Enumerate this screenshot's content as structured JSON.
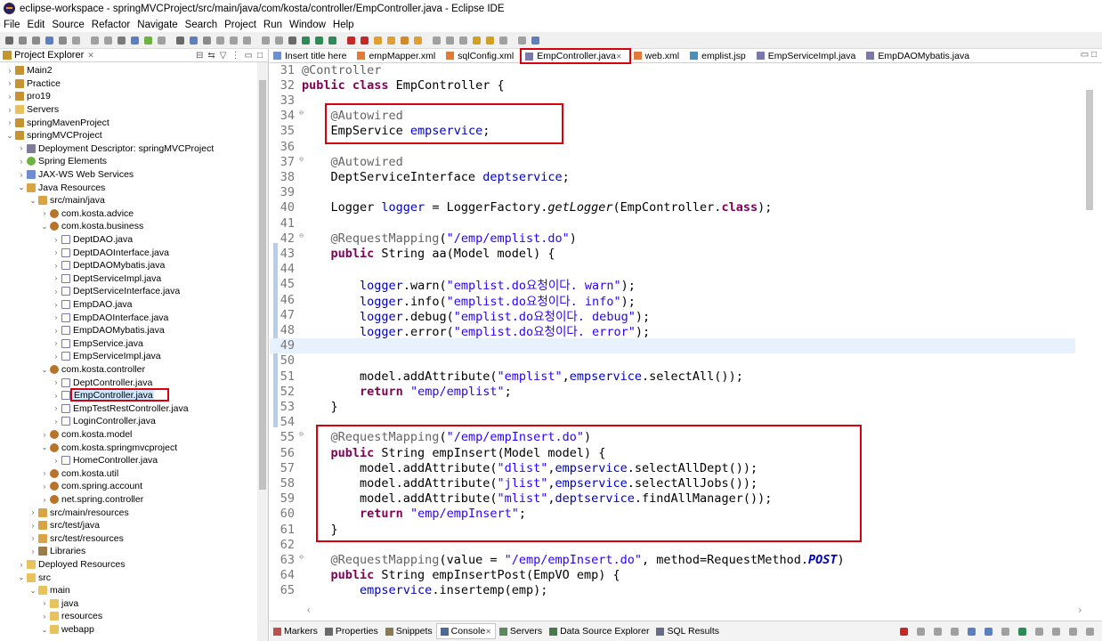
{
  "window": {
    "title": "eclipse-workspace - springMVCProject/src/main/java/com/kosta/controller/EmpController.java - Eclipse IDE"
  },
  "menu": [
    "File",
    "Edit",
    "Source",
    "Refactor",
    "Navigate",
    "Search",
    "Project",
    "Run",
    "Window",
    "Help"
  ],
  "explorer": {
    "title": "Project Explorer"
  },
  "tree": [
    {
      "label": "Main2",
      "indent": 0,
      "arrow": "›",
      "icon": "proj"
    },
    {
      "label": "Practice",
      "indent": 0,
      "arrow": "›",
      "icon": "proj"
    },
    {
      "label": "pro19",
      "indent": 0,
      "arrow": "›",
      "icon": "proj"
    },
    {
      "label": "Servers",
      "indent": 0,
      "arrow": "›",
      "icon": "folder"
    },
    {
      "label": "springMavenProject",
      "indent": 0,
      "arrow": "›",
      "icon": "proj"
    },
    {
      "label": "springMVCProject",
      "indent": 0,
      "arrow": "⌄",
      "icon": "proj"
    },
    {
      "label": "Deployment Descriptor: springMVCProject",
      "indent": 1,
      "arrow": "›",
      "icon": "dd"
    },
    {
      "label": "Spring Elements",
      "indent": 1,
      "arrow": "›",
      "icon": "spring"
    },
    {
      "label": "JAX-WS Web Services",
      "indent": 1,
      "arrow": "›",
      "icon": "web"
    },
    {
      "label": "Java Resources",
      "indent": 1,
      "arrow": "⌄",
      "icon": "src"
    },
    {
      "label": "src/main/java",
      "indent": 2,
      "arrow": "⌄",
      "icon": "src"
    },
    {
      "label": "com.kosta.advice",
      "indent": 3,
      "arrow": "›",
      "icon": "pkg"
    },
    {
      "label": "com.kosta.business",
      "indent": 3,
      "arrow": "⌄",
      "icon": "pkg"
    },
    {
      "label": "DeptDAO.java",
      "indent": 4,
      "arrow": "›",
      "icon": "java"
    },
    {
      "label": "DeptDAOInterface.java",
      "indent": 4,
      "arrow": "›",
      "icon": "java"
    },
    {
      "label": "DeptDAOMybatis.java",
      "indent": 4,
      "arrow": "›",
      "icon": "java"
    },
    {
      "label": "DeptServiceImpl.java",
      "indent": 4,
      "arrow": "›",
      "icon": "java"
    },
    {
      "label": "DeptServiceInterface.java",
      "indent": 4,
      "arrow": "›",
      "icon": "java"
    },
    {
      "label": "EmpDAO.java",
      "indent": 4,
      "arrow": "›",
      "icon": "java"
    },
    {
      "label": "EmpDAOInterface.java",
      "indent": 4,
      "arrow": "›",
      "icon": "java"
    },
    {
      "label": "EmpDAOMybatis.java",
      "indent": 4,
      "arrow": "›",
      "icon": "java"
    },
    {
      "label": "EmpService.java",
      "indent": 4,
      "arrow": "›",
      "icon": "java"
    },
    {
      "label": "EmpServiceImpl.java",
      "indent": 4,
      "arrow": "›",
      "icon": "java"
    },
    {
      "label": "com.kosta.controller",
      "indent": 3,
      "arrow": "⌄",
      "icon": "pkg"
    },
    {
      "label": "DeptController.java",
      "indent": 4,
      "arrow": "›",
      "icon": "java"
    },
    {
      "label": "EmpController.java",
      "indent": 4,
      "arrow": "›",
      "icon": "java",
      "selected": true
    },
    {
      "label": "EmpTestRestController.java",
      "indent": 4,
      "arrow": "›",
      "icon": "java"
    },
    {
      "label": "LoginController.java",
      "indent": 4,
      "arrow": "›",
      "icon": "java"
    },
    {
      "label": "com.kosta.model",
      "indent": 3,
      "arrow": "›",
      "icon": "pkg"
    },
    {
      "label": "com.kosta.springmvcproject",
      "indent": 3,
      "arrow": "⌄",
      "icon": "pkg"
    },
    {
      "label": "HomeController.java",
      "indent": 4,
      "arrow": "›",
      "icon": "java"
    },
    {
      "label": "com.kosta.util",
      "indent": 3,
      "arrow": "›",
      "icon": "pkg"
    },
    {
      "label": "com.spring.account",
      "indent": 3,
      "arrow": "›",
      "icon": "pkg"
    },
    {
      "label": "net.spring.controller",
      "indent": 3,
      "arrow": "›",
      "icon": "pkg"
    },
    {
      "label": "src/main/resources",
      "indent": 2,
      "arrow": "›",
      "icon": "src"
    },
    {
      "label": "src/test/java",
      "indent": 2,
      "arrow": "›",
      "icon": "src"
    },
    {
      "label": "src/test/resources",
      "indent": 2,
      "arrow": "›",
      "icon": "src"
    },
    {
      "label": "Libraries",
      "indent": 2,
      "arrow": "›",
      "icon": "lib"
    },
    {
      "label": "Deployed Resources",
      "indent": 1,
      "arrow": "›",
      "icon": "folder"
    },
    {
      "label": "src",
      "indent": 1,
      "arrow": "⌄",
      "icon": "folder"
    },
    {
      "label": "main",
      "indent": 2,
      "arrow": "⌄",
      "icon": "folder"
    },
    {
      "label": "java",
      "indent": 3,
      "arrow": "›",
      "icon": "folder"
    },
    {
      "label": "resources",
      "indent": 3,
      "arrow": "›",
      "icon": "folder"
    },
    {
      "label": "webapp",
      "indent": 3,
      "arrow": "⌄",
      "icon": "folder"
    }
  ],
  "tabs": [
    {
      "label": "Insert title here",
      "icon": "web"
    },
    {
      "label": "empMapper.xml",
      "icon": "xml"
    },
    {
      "label": "sqlConfig.xml",
      "icon": "xml"
    },
    {
      "label": "EmpController.java",
      "icon": "java",
      "active": true
    },
    {
      "label": "web.xml",
      "icon": "xml"
    },
    {
      "label": "emplist.jsp",
      "icon": "jsp"
    },
    {
      "label": "EmpServiceImpl.java",
      "icon": "java"
    },
    {
      "label": "EmpDAOMybatis.java",
      "icon": "java"
    }
  ],
  "code": [
    {
      "n": "31",
      "fold": "",
      "t": [
        [
          "an",
          "@Controller"
        ]
      ]
    },
    {
      "n": "32",
      "fold": "",
      "t": [
        [
          "kw",
          "public class "
        ],
        [
          "",
          "EmpController {"
        ]
      ]
    },
    {
      "n": "33",
      "fold": "",
      "t": []
    },
    {
      "n": "34",
      "fold": "⊖",
      "t": [
        [
          "",
          "    "
        ],
        [
          "an",
          "@Autowired"
        ]
      ]
    },
    {
      "n": "35",
      "fold": "",
      "t": [
        [
          "",
          "    EmpService "
        ],
        [
          "fld",
          "empservice"
        ],
        [
          "",
          ";"
        ]
      ]
    },
    {
      "n": "36",
      "fold": "",
      "t": []
    },
    {
      "n": "37",
      "fold": "⊖",
      "t": [
        [
          "",
          "    "
        ],
        [
          "an",
          "@Autowired"
        ]
      ]
    },
    {
      "n": "38",
      "fold": "",
      "t": [
        [
          "",
          "    DeptServiceInterface "
        ],
        [
          "fld",
          "deptservice"
        ],
        [
          "",
          ";"
        ]
      ]
    },
    {
      "n": "39",
      "fold": "",
      "t": []
    },
    {
      "n": "40",
      "fold": "",
      "t": [
        [
          "",
          "    Logger "
        ],
        [
          "fld",
          "logger"
        ],
        [
          "",
          " = LoggerFactory."
        ],
        [
          "it",
          "getLogger"
        ],
        [
          "",
          "(EmpController."
        ],
        [
          "kw",
          "class"
        ],
        [
          "",
          ");"
        ]
      ]
    },
    {
      "n": "41",
      "fold": "",
      "t": []
    },
    {
      "n": "42",
      "fold": "⊖",
      "t": [
        [
          "",
          "    "
        ],
        [
          "an",
          "@RequestMapping"
        ],
        [
          "",
          "("
        ],
        [
          "str",
          "\"/emp/emplist.do\""
        ],
        [
          "",
          ")"
        ]
      ]
    },
    {
      "n": "43",
      "fold": "",
      "t": [
        [
          "",
          "    "
        ],
        [
          "kw",
          "public "
        ],
        [
          "",
          "String aa(Model model) {"
        ]
      ]
    },
    {
      "n": "44",
      "fold": "",
      "t": []
    },
    {
      "n": "45",
      "fold": "",
      "t": [
        [
          "",
          "        "
        ],
        [
          "fld",
          "logger"
        ],
        [
          "",
          ".warn("
        ],
        [
          "str",
          "\"emplist.do요청이다. warn\""
        ],
        [
          "",
          ");"
        ]
      ]
    },
    {
      "n": "46",
      "fold": "",
      "t": [
        [
          "",
          "        "
        ],
        [
          "fld",
          "logger"
        ],
        [
          "",
          ".info("
        ],
        [
          "str",
          "\"emplist.do요청이다. info\""
        ],
        [
          "",
          ");"
        ]
      ]
    },
    {
      "n": "47",
      "fold": "",
      "t": [
        [
          "",
          "        "
        ],
        [
          "fld",
          "logger"
        ],
        [
          "",
          ".debug("
        ],
        [
          "str",
          "\"emplist.do요청이다. debug\""
        ],
        [
          "",
          ");"
        ]
      ]
    },
    {
      "n": "48",
      "fold": "",
      "t": [
        [
          "",
          "        "
        ],
        [
          "fld",
          "logger"
        ],
        [
          "",
          ".error("
        ],
        [
          "str",
          "\"emplist.do요청이다. error\""
        ],
        [
          "",
          ");"
        ]
      ]
    },
    {
      "n": "49",
      "fold": "",
      "t": [],
      "current": true
    },
    {
      "n": "50",
      "fold": "",
      "t": []
    },
    {
      "n": "51",
      "fold": "",
      "t": [
        [
          "",
          "        model.addAttribute("
        ],
        [
          "str",
          "\"emplist\""
        ],
        [
          "",
          ","
        ],
        [
          "fld",
          "empservice"
        ],
        [
          "",
          ".selectAll());"
        ]
      ]
    },
    {
      "n": "52",
      "fold": "",
      "t": [
        [
          "",
          "        "
        ],
        [
          "kw",
          "return "
        ],
        [
          "str",
          "\"emp/emplist\""
        ],
        [
          "",
          ";"
        ]
      ]
    },
    {
      "n": "53",
      "fold": "",
      "t": [
        [
          "",
          "    }"
        ]
      ]
    },
    {
      "n": "54",
      "fold": "",
      "t": []
    },
    {
      "n": "55",
      "fold": "⊖",
      "t": [
        [
          "",
          "    "
        ],
        [
          "an",
          "@RequestMapping"
        ],
        [
          "",
          "("
        ],
        [
          "str",
          "\"/emp/empInsert.do\""
        ],
        [
          "",
          ")"
        ]
      ]
    },
    {
      "n": "56",
      "fold": "",
      "t": [
        [
          "",
          "    "
        ],
        [
          "kw",
          "public "
        ],
        [
          "",
          "String empInsert(Model model) {"
        ]
      ]
    },
    {
      "n": "57",
      "fold": "",
      "t": [
        [
          "",
          "        model.addAttribute("
        ],
        [
          "str",
          "\"dlist\""
        ],
        [
          "",
          ","
        ],
        [
          "fld",
          "empservice"
        ],
        [
          "",
          ".selectAllDept());"
        ]
      ]
    },
    {
      "n": "58",
      "fold": "",
      "t": [
        [
          "",
          "        model.addAttribute("
        ],
        [
          "str",
          "\"jlist\""
        ],
        [
          "",
          ","
        ],
        [
          "fld",
          "empservice"
        ],
        [
          "",
          ".selectAllJobs());"
        ]
      ]
    },
    {
      "n": "59",
      "fold": "",
      "t": [
        [
          "",
          "        model.addAttribute("
        ],
        [
          "str",
          "\"mlist\""
        ],
        [
          "",
          ","
        ],
        [
          "fld",
          "deptservice"
        ],
        [
          "",
          ".findAllManager());"
        ]
      ]
    },
    {
      "n": "60",
      "fold": "",
      "t": [
        [
          "",
          "        "
        ],
        [
          "kw",
          "return "
        ],
        [
          "str",
          "\"emp/empInsert\""
        ],
        [
          "",
          ";"
        ]
      ]
    },
    {
      "n": "61",
      "fold": "",
      "t": [
        [
          "",
          "    }"
        ]
      ]
    },
    {
      "n": "62",
      "fold": "",
      "t": []
    },
    {
      "n": "63",
      "fold": "⊖",
      "t": [
        [
          "",
          "    "
        ],
        [
          "an",
          "@RequestMapping"
        ],
        [
          "",
          "(value = "
        ],
        [
          "str",
          "\"/emp/empInsert.do\""
        ],
        [
          "",
          ", method=RequestMethod."
        ],
        [
          "itb",
          "POST"
        ],
        [
          "",
          ")"
        ]
      ]
    },
    {
      "n": "64",
      "fold": "",
      "t": [
        [
          "",
          "    "
        ],
        [
          "kw",
          "public "
        ],
        [
          "",
          "String empInsertPost(EmpVO emp) {"
        ]
      ]
    },
    {
      "n": "65",
      "fold": "",
      "t": [
        [
          "",
          "        "
        ],
        [
          "fld",
          "empservice"
        ],
        [
          "",
          ".insertemp(emp);"
        ]
      ]
    }
  ],
  "bottom_tabs": [
    {
      "label": "Markers",
      "icon": "markers"
    },
    {
      "label": "Properties",
      "icon": "properties"
    },
    {
      "label": "Snippets",
      "icon": "snippets"
    },
    {
      "label": "Console",
      "icon": "console",
      "active": true
    },
    {
      "label": "Servers",
      "icon": "servers"
    },
    {
      "label": "Data Source Explorer",
      "icon": "datasource"
    },
    {
      "label": "SQL Results",
      "icon": "sql"
    }
  ],
  "colors": {
    "highlight_box": "#d9000e",
    "keyword": "#7f0055",
    "string": "#2a00ff",
    "field": "#0000c0",
    "annotation": "#646464"
  }
}
